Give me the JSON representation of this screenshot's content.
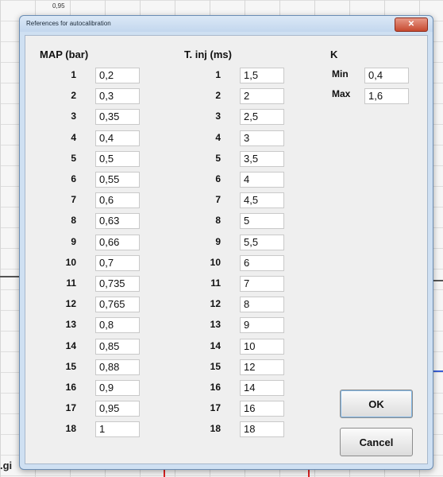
{
  "background": {
    "top_tick_label": "0,95",
    "left_fragment_label": ".gi"
  },
  "dialog": {
    "title": "References for autocalibration",
    "close_glyph": "✕"
  },
  "map": {
    "title": "MAP (bar)",
    "rows": [
      {
        "n": "1",
        "v": "0,2"
      },
      {
        "n": "2",
        "v": "0,3"
      },
      {
        "n": "3",
        "v": "0,35"
      },
      {
        "n": "4",
        "v": "0,4"
      },
      {
        "n": "5",
        "v": "0,5"
      },
      {
        "n": "6",
        "v": "0,55"
      },
      {
        "n": "7",
        "v": "0,6"
      },
      {
        "n": "8",
        "v": "0,63"
      },
      {
        "n": "9",
        "v": "0,66"
      },
      {
        "n": "10",
        "v": "0,7"
      },
      {
        "n": "11",
        "v": "0,735"
      },
      {
        "n": "12",
        "v": "0,765"
      },
      {
        "n": "13",
        "v": "0,8"
      },
      {
        "n": "14",
        "v": "0,85"
      },
      {
        "n": "15",
        "v": "0,88"
      },
      {
        "n": "16",
        "v": "0,9"
      },
      {
        "n": "17",
        "v": "0,95"
      },
      {
        "n": "18",
        "v": "1"
      }
    ]
  },
  "tinj": {
    "title": "T. inj (ms)",
    "rows": [
      {
        "n": "1",
        "v": "1,5"
      },
      {
        "n": "2",
        "v": "2"
      },
      {
        "n": "3",
        "v": "2,5"
      },
      {
        "n": "4",
        "v": "3"
      },
      {
        "n": "5",
        "v": "3,5"
      },
      {
        "n": "6",
        "v": "4"
      },
      {
        "n": "7",
        "v": "4,5"
      },
      {
        "n": "8",
        "v": "5"
      },
      {
        "n": "9",
        "v": "5,5"
      },
      {
        "n": "10",
        "v": "6"
      },
      {
        "n": "11",
        "v": "7"
      },
      {
        "n": "12",
        "v": "8"
      },
      {
        "n": "13",
        "v": "9"
      },
      {
        "n": "14",
        "v": "10"
      },
      {
        "n": "15",
        "v": "12"
      },
      {
        "n": "16",
        "v": "14"
      },
      {
        "n": "17",
        "v": "16"
      },
      {
        "n": "18",
        "v": "18"
      }
    ]
  },
  "k": {
    "title": "K",
    "min_label": "Min",
    "min_value": "0,4",
    "max_label": "Max",
    "max_value": "1,6"
  },
  "buttons": {
    "ok": "OK",
    "cancel": "Cancel"
  }
}
